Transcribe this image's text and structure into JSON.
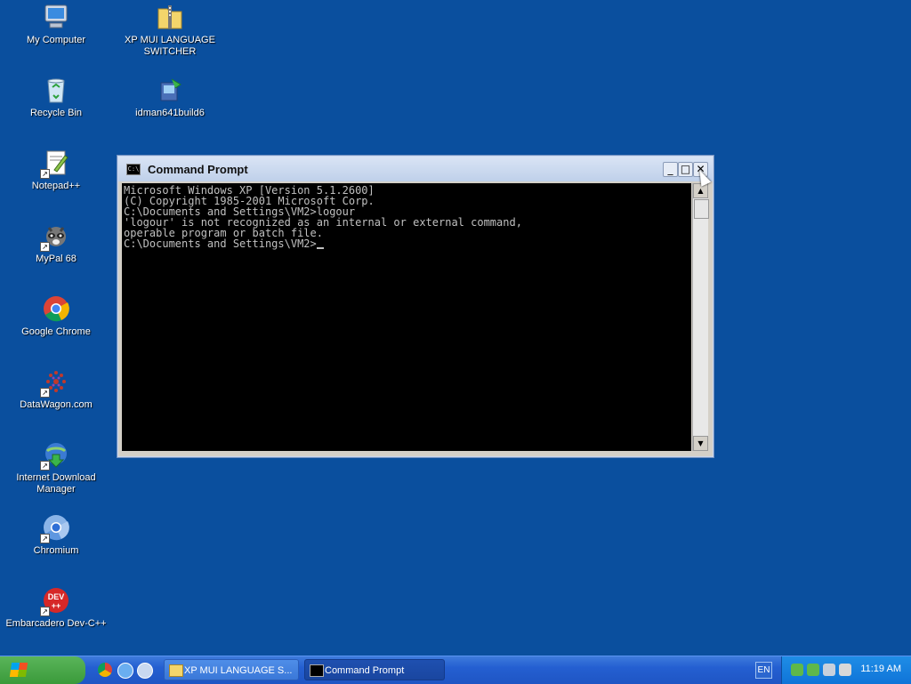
{
  "desktop": {
    "icons": [
      {
        "label": "My Computer"
      },
      {
        "label": "XP MUI LANGUAGE SWITCHER"
      },
      {
        "label": "Recycle Bin"
      },
      {
        "label": "idman641build6"
      },
      {
        "label": "Notepad++"
      },
      {
        "label": "MyPal 68"
      },
      {
        "label": "Google Chrome"
      },
      {
        "label": "DataWagon.com"
      },
      {
        "label": "Internet Download Manager"
      },
      {
        "label": "Chromium"
      },
      {
        "label": "Embarcadero Dev-C++"
      }
    ]
  },
  "window": {
    "title": "Command Prompt",
    "icon_text": "C:\\",
    "buttons": {
      "minimize": "_",
      "maximize": "□",
      "close": "✕"
    },
    "console_lines": [
      "Microsoft Windows XP [Version 5.1.2600]",
      "(C) Copyright 1985-2001 Microsoft Corp.",
      "",
      "C:\\Documents and Settings\\VM2>logour",
      "'logour' is not recognized as an internal or external command,",
      "operable program or batch file.",
      "",
      "C:\\Documents and Settings\\VM2>"
    ]
  },
  "taskbar": {
    "tasks": [
      {
        "label": "XP MUI LANGUAGE S..."
      },
      {
        "label": "Command Prompt"
      }
    ],
    "language": "EN",
    "clock": "11:19 AM"
  },
  "icons": [
    "computer-icon",
    "folder-zip-icon",
    "recycle-bin-icon",
    "installer-icon",
    "notepad-icon",
    "raccoon-icon",
    "chrome-icon",
    "datawagon-icon",
    "idm-icon",
    "chromium-icon",
    "devcpp-icon"
  ]
}
